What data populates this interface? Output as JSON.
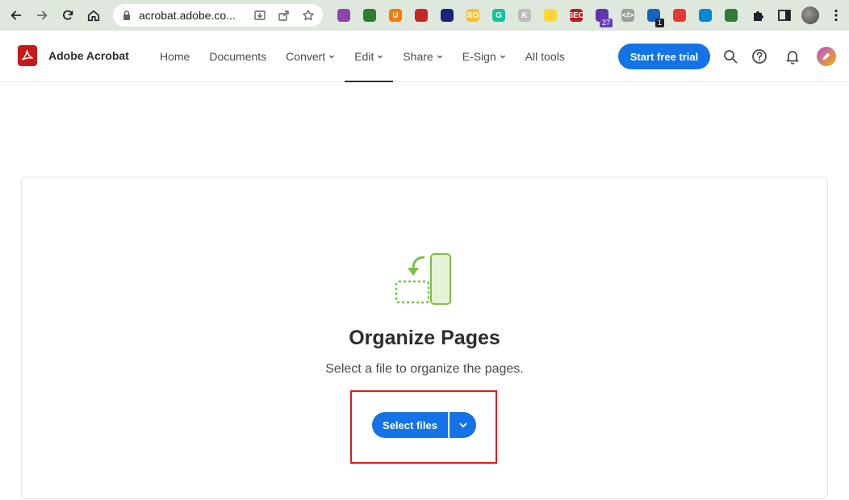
{
  "browser": {
    "url": "acrobat.adobe.co...",
    "extensions": [
      {
        "name": "quill-extension-icon",
        "color": "#8e44ad",
        "text": ""
      },
      {
        "name": "globe-extension-icon",
        "color": "#2e7d32",
        "text": ""
      },
      {
        "name": "ublock-extension-icon",
        "color": "#f57c00",
        "text": "U"
      },
      {
        "name": "eyes-extension-icon",
        "color": "#c62828",
        "text": ""
      },
      {
        "name": "wave-extension-icon",
        "color": "#1a237e",
        "text": ""
      },
      {
        "name": "seo-extension-icon",
        "color": "#fbc02d",
        "text": "SO"
      },
      {
        "name": "grammarly-extension-icon",
        "color": "#15c39a",
        "text": "G"
      },
      {
        "name": "k-extension-icon",
        "color": "#bdbdbd",
        "text": "K"
      },
      {
        "name": "bookmark-extension-icon",
        "color": "#fdd835",
        "text": ""
      },
      {
        "name": "seo-tool-extension-icon",
        "color": "#b71c1c",
        "text": "SEO"
      },
      {
        "name": "grad-cap-extension-icon",
        "color": "#5e35b1",
        "text": "",
        "badge": "27"
      },
      {
        "name": "code-extension-icon",
        "color": "#9e9e9e",
        "text": "</>"
      },
      {
        "name": "link-extension-icon",
        "color": "#1565c0",
        "text": "",
        "badge": "1"
      },
      {
        "name": "color-extension-icon",
        "color": "#e53935",
        "text": ""
      },
      {
        "name": "target-extension-icon",
        "color": "#0288d1",
        "text": ""
      },
      {
        "name": "alien-extension-icon",
        "color": "#2e7d32",
        "text": ""
      }
    ]
  },
  "header": {
    "brand_name": "Adobe Acrobat",
    "nav": [
      {
        "label": "Home",
        "dropdown": false
      },
      {
        "label": "Documents",
        "dropdown": false
      },
      {
        "label": "Convert",
        "dropdown": true
      },
      {
        "label": "Edit",
        "dropdown": true,
        "active": true
      },
      {
        "label": "Share",
        "dropdown": true
      },
      {
        "label": "E-Sign",
        "dropdown": true
      },
      {
        "label": "All tools",
        "dropdown": false
      }
    ],
    "cta_label": "Start free trial"
  },
  "main": {
    "title": "Organize Pages",
    "subtitle": "Select a file to organize the pages.",
    "select_label": "Select files"
  },
  "colors": {
    "brand_red": "#c81a1a",
    "accent_blue": "#1473e6",
    "illustration_green": "#7ac143",
    "highlight_red": "#e0191b"
  }
}
